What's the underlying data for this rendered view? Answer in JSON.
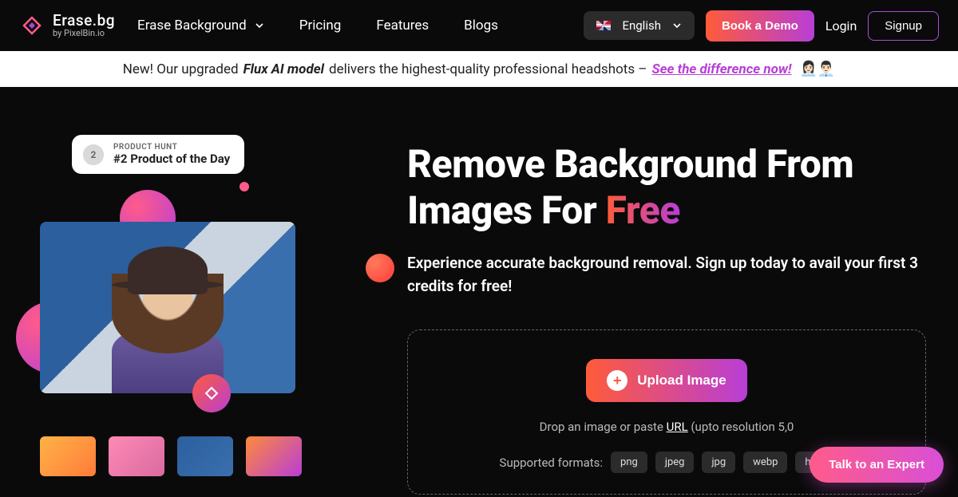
{
  "brand": {
    "title": "Erase.bg",
    "subtitle": "by PixelBin.io"
  },
  "nav": {
    "erase_bg": "Erase Background",
    "pricing": "Pricing",
    "features": "Features",
    "blogs": "Blogs"
  },
  "header": {
    "language": "English",
    "demo": "Book a Demo",
    "login": "Login",
    "signup": "Signup"
  },
  "banner": {
    "prefix": "New! Our upgraded ",
    "model": "Flux AI model",
    "middle": " delivers the highest-quality professional headshots – ",
    "cta": "See the difference now!",
    "emoji": "👩🏻‍💼👨🏻‍💼"
  },
  "ph": {
    "medal": "2",
    "label": "PRODUCT HUNT",
    "title": "#2 Product of the Day"
  },
  "hero": {
    "headline_pre": "Remove Background From Images For ",
    "headline_free": "Free",
    "subhead": "Experience accurate background removal. Sign up today to avail your first 3 credits for free!"
  },
  "upload": {
    "button": "Upload Image",
    "drop_pre": "Drop an image or paste ",
    "url": "URL",
    "drop_post": " (upto resolution 5,0",
    "formats_label": "Supported formats:",
    "formats": [
      "png",
      "jpeg",
      "jpg",
      "webp",
      "heic"
    ]
  },
  "talk": "Talk to an Expert"
}
